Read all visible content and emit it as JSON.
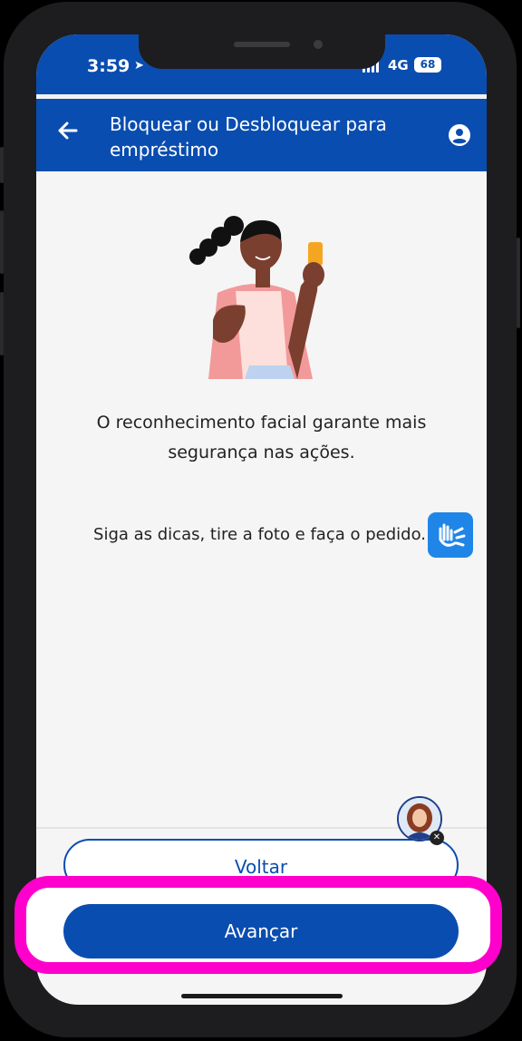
{
  "status_bar": {
    "time": "3:59",
    "network": "4G",
    "battery": "68"
  },
  "header": {
    "title": "Bloquear ou Desbloquear para empréstimo",
    "back_icon": "arrow-left-icon",
    "profile_icon": "user-circle-icon"
  },
  "content": {
    "description": "O reconhecimento facial garante mais segurança nas ações.",
    "instruction": "Siga as dicas, tire a foto e faça o pedido.",
    "libras_icon": "sign-language-hands-icon"
  },
  "buttons": {
    "back_label": "Voltar",
    "next_label": "Avançar"
  },
  "colors": {
    "brand_blue": "#0a4db0",
    "accessibility_blue": "#1f86e8",
    "highlight": "#ff00cc"
  }
}
